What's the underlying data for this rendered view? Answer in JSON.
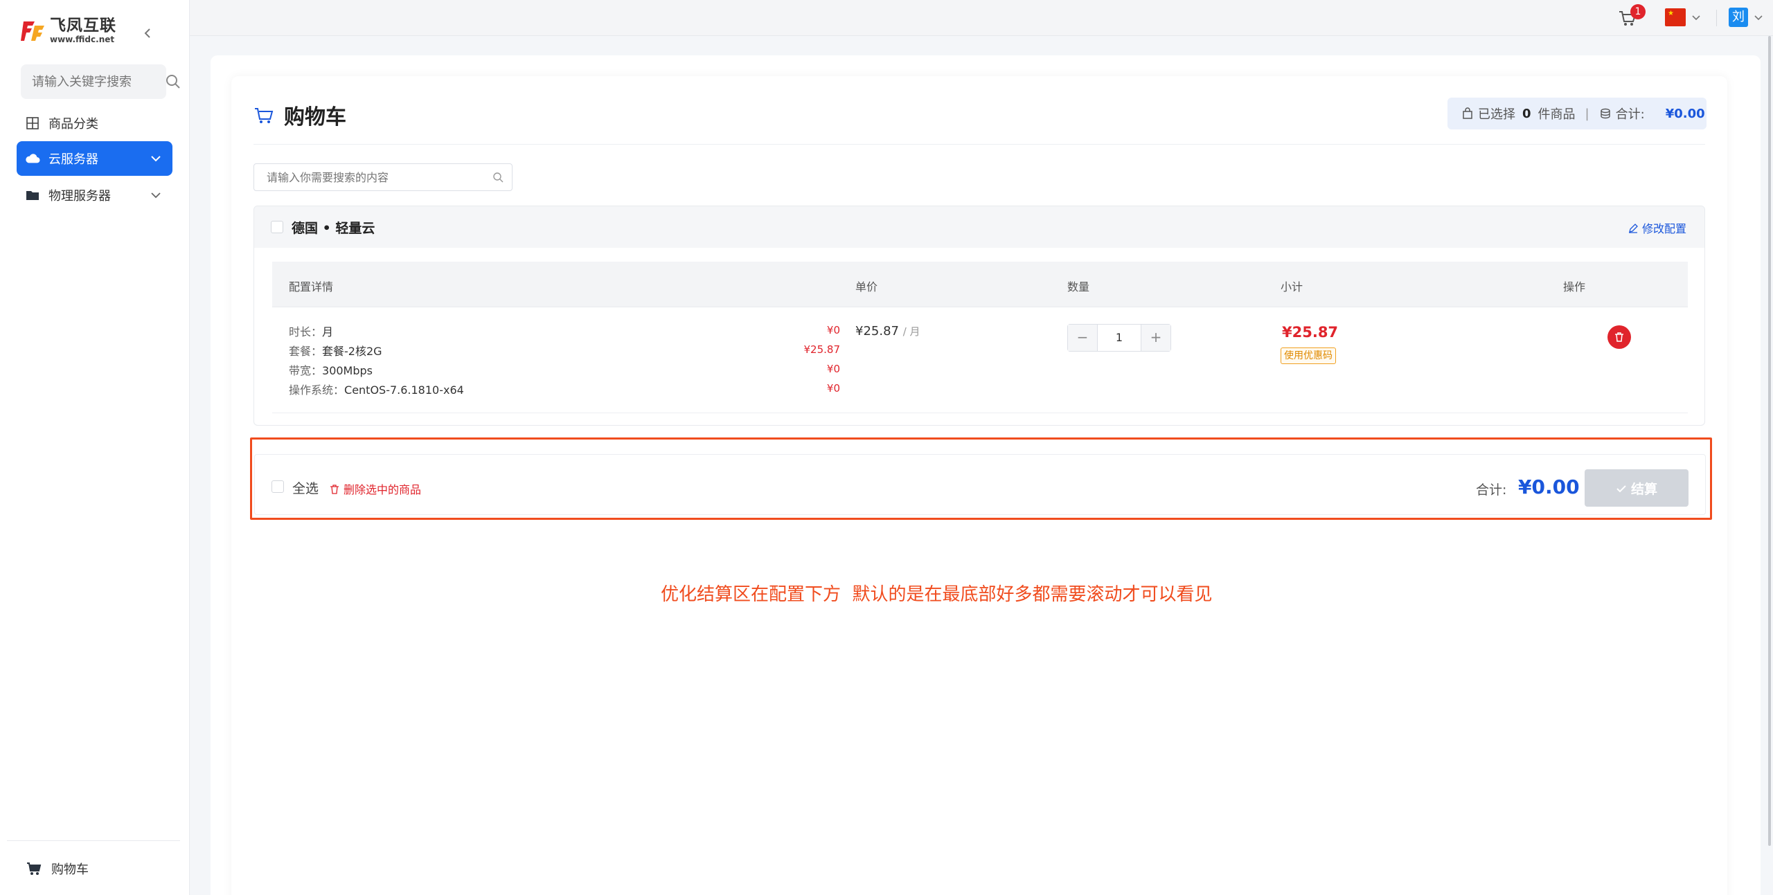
{
  "brand": {
    "name": "飞凤互联",
    "url": "www.ffidc.net",
    "accent": "#1a6df0",
    "logo_colors": [
      "#e0242c",
      "#f5a623"
    ]
  },
  "sidebar": {
    "search_placeholder": "请输入关键字搜索",
    "items": [
      {
        "label": "商品分类",
        "icon": "grid-icon",
        "active": false
      },
      {
        "label": "云服务器",
        "icon": "cloud-icon",
        "active": true
      },
      {
        "label": "物理服务器",
        "icon": "folder-icon",
        "active": false
      }
    ],
    "bottom": {
      "label": "购物车",
      "icon": "cart-icon"
    }
  },
  "topbar": {
    "cart_count": "1",
    "language": "China flag",
    "user_initial": "刘"
  },
  "page": {
    "title": "购物车",
    "summary": {
      "selected_prefix": "已选择",
      "selected_count": "0",
      "selected_suffix": "件商品",
      "divider": "|",
      "total_label": "合计:",
      "total_value": "¥0.00"
    },
    "search_placeholder": "请输入你需要搜索的内容"
  },
  "product": {
    "name": "德国 • 轻量云",
    "edit_label": "修改配置",
    "columns": [
      "配置详情",
      "单价",
      "数量",
      "小计",
      "操作"
    ],
    "details": [
      {
        "label": "时长：",
        "value": "月",
        "price": "¥0"
      },
      {
        "label": "套餐：",
        "value": "套餐-2核2G",
        "price": "¥25.87"
      },
      {
        "label": "带宽：",
        "value": "300Mbps",
        "price": "¥0"
      },
      {
        "label": "操作系统：",
        "value": "CentOS-7.6.1810-x64",
        "price": "¥0"
      }
    ],
    "unit_price": "¥25.87",
    "unit_period": "/ 月",
    "quantity": "1",
    "minus": "−",
    "plus": "+",
    "subtotal": "¥25.87",
    "coupon_label": "使用优惠码"
  },
  "checkout": {
    "select_all": "全选",
    "delete_selected": "删除选中的商品",
    "total_label": "合计:",
    "total_value": "¥0.00",
    "button_label": "结算",
    "outline_color": "#f04c1e"
  },
  "annotation": "优化结算区在配置下方  默认的是在最底部好多都需要滚动才可以看见"
}
